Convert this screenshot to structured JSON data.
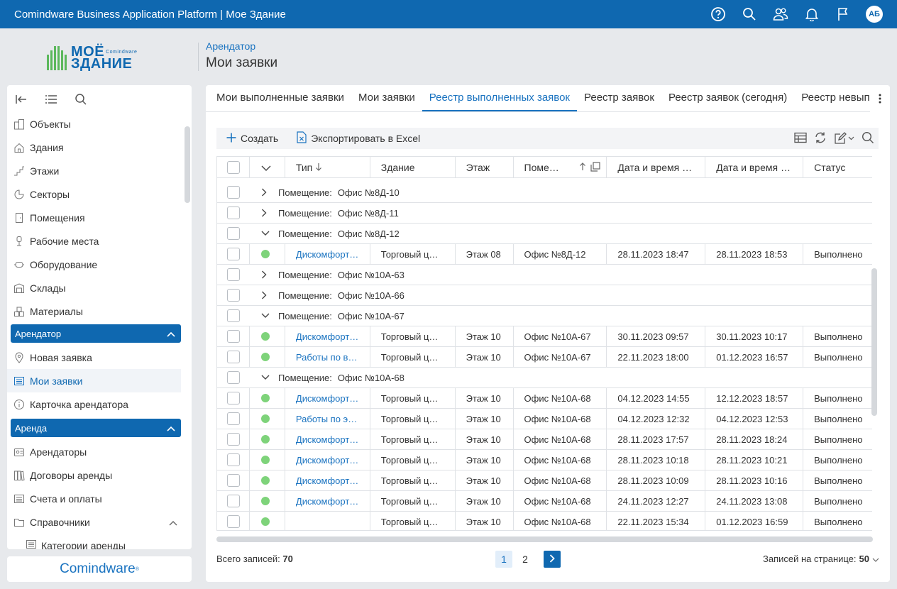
{
  "app": {
    "title": "Comindware Business Application Platform  |  Мое Здание",
    "avatar": "АБ"
  },
  "logo": {
    "line1": "МОЁ",
    "line1_small": "Comindware",
    "line2": "ЗДАНИЕ"
  },
  "header": {
    "breadcrumb": "Арендатор",
    "title": "Мои заявки"
  },
  "sidebar": {
    "items": [
      {
        "label": "Объекты",
        "icon": "objects-icon"
      },
      {
        "label": "Здания",
        "icon": "home-icon"
      },
      {
        "label": "Этажи",
        "icon": "stairs-icon"
      },
      {
        "label": "Секторы",
        "icon": "pie-icon"
      },
      {
        "label": "Помещения",
        "icon": "door-icon"
      },
      {
        "label": "Рабочие места",
        "icon": "chair-icon"
      },
      {
        "label": "Оборудование",
        "icon": "equipment-icon"
      },
      {
        "label": "Склады",
        "icon": "warehouse-icon"
      },
      {
        "label": "Материалы",
        "icon": "boxes-icon"
      }
    ],
    "group1": {
      "label": "Арендатор",
      "items": [
        {
          "label": "Новая заявка",
          "icon": "pin-icon"
        },
        {
          "label": "Мои заявки",
          "icon": "list-icon"
        },
        {
          "label": "Карточка арендатора",
          "icon": "info-icon"
        }
      ]
    },
    "group2": {
      "label": "Аренда",
      "items": [
        {
          "label": "Арендаторы",
          "icon": "tenants-icon"
        },
        {
          "label": "Договоры аренды",
          "icon": "contracts-icon"
        },
        {
          "label": "Счета и оплаты",
          "icon": "list-icon"
        },
        {
          "label": "Справочники",
          "icon": "folder-icon"
        }
      ],
      "sub": [
        {
          "label": "Категории аренды",
          "icon": "list-icon"
        }
      ]
    },
    "brand": "Comindware"
  },
  "tabs": [
    {
      "label": "Мои выполненные заявки",
      "active": false
    },
    {
      "label": "Мои заявки",
      "active": false
    },
    {
      "label": "Реестр выполненных заявок",
      "active": true
    },
    {
      "label": "Реестр заявок",
      "active": false
    },
    {
      "label": "Реестр заявок (сегодня)",
      "active": false
    },
    {
      "label": "Реестр невыпо",
      "active": false
    }
  ],
  "toolbar": {
    "create": "Создать",
    "export": "Экспортировать в Excel"
  },
  "columns": [
    "Тип",
    "Здание",
    "Этаж",
    "Поме…",
    "Дата и время …",
    "Дата и время …",
    "Статус"
  ],
  "rows": [
    {
      "kind": "group",
      "expanded": false,
      "label": "Помещение:",
      "value": "Офис №8Д-10"
    },
    {
      "kind": "group",
      "expanded": false,
      "label": "Помещение:",
      "value": "Офис №8Д-11"
    },
    {
      "kind": "group",
      "expanded": true,
      "label": "Помещение:",
      "value": "Офис №8Д-12"
    },
    {
      "kind": "data",
      "type": "Дискомфорт…",
      "building": "Торговый ц…",
      "floor": "Этаж 08",
      "room": "Офис №8Д-12",
      "d1": "28.11.2023 18:47",
      "d2": "28.11.2023 18:53",
      "status": "Выполнено"
    },
    {
      "kind": "group",
      "expanded": false,
      "label": "Помещение:",
      "value": "Офис №10А-63"
    },
    {
      "kind": "group",
      "expanded": false,
      "label": "Помещение:",
      "value": "Офис №10А-66"
    },
    {
      "kind": "group",
      "expanded": true,
      "label": "Помещение:",
      "value": "Офис №10А-67"
    },
    {
      "kind": "data",
      "type": "Дискомфорт…",
      "building": "Торговый ц…",
      "floor": "Этаж 10",
      "room": "Офис №10А-67",
      "d1": "30.11.2023 09:57",
      "d2": "30.11.2023 10:17",
      "status": "Выполнено"
    },
    {
      "kind": "data",
      "type": "Работы по в…",
      "building": "Торговый ц…",
      "floor": "Этаж 10",
      "room": "Офис №10А-67",
      "d1": "22.11.2023 18:00",
      "d2": "01.12.2023 16:57",
      "status": "Выполнено"
    },
    {
      "kind": "group",
      "expanded": true,
      "label": "Помещение:",
      "value": "Офис №10А-68"
    },
    {
      "kind": "data",
      "type": "Дискомфорт…",
      "building": "Торговый ц…",
      "floor": "Этаж 10",
      "room": "Офис №10А-68",
      "d1": "04.12.2023 14:55",
      "d2": "12.12.2023 18:57",
      "status": "Выполнено"
    },
    {
      "kind": "data",
      "type": "Работы по э…",
      "building": "Торговый ц…",
      "floor": "Этаж 10",
      "room": "Офис №10А-68",
      "d1": "04.12.2023 12:32",
      "d2": "04.12.2023 12:53",
      "status": "Выполнено"
    },
    {
      "kind": "data",
      "type": "Дискомфорт…",
      "building": "Торговый ц…",
      "floor": "Этаж 10",
      "room": "Офис №10А-68",
      "d1": "28.11.2023 17:57",
      "d2": "28.11.2023 18:24",
      "status": "Выполнено"
    },
    {
      "kind": "data",
      "type": "Дискомфорт…",
      "building": "Торговый ц…",
      "floor": "Этаж 10",
      "room": "Офис №10А-68",
      "d1": "28.11.2023 10:18",
      "d2": "28.11.2023 10:21",
      "status": "Выполнено"
    },
    {
      "kind": "data",
      "type": "Дискомфорт…",
      "building": "Торговый ц…",
      "floor": "Этаж 10",
      "room": "Офис №10А-68",
      "d1": "28.11.2023 10:09",
      "d2": "28.11.2023 10:16",
      "status": "Выполнено"
    },
    {
      "kind": "data",
      "type": "Дискомфорт…",
      "building": "Торговый ц…",
      "floor": "Этаж 10",
      "room": "Офис №10А-68",
      "d1": "24.11.2023 12:27",
      "d2": "24.11.2023 13:08",
      "status": "Выполнено"
    },
    {
      "kind": "data",
      "type": "",
      "building": "Торговый ц…",
      "floor": "Этаж 10",
      "room": "Офис №10А-68",
      "d1": "22.11.2023 15:34",
      "d2": "01.12.2023 16:59",
      "status": "Выполнено"
    }
  ],
  "footer": {
    "total_label": "Всего записей:",
    "total_value": "70",
    "pages": [
      "1",
      "2"
    ],
    "current_page": "1",
    "per_page_label": "Записей на странице:",
    "per_page_value": "50"
  },
  "colors": {
    "primary": "#0f68b0",
    "link": "#1a73c0",
    "status_dot": "#7ed37a"
  }
}
